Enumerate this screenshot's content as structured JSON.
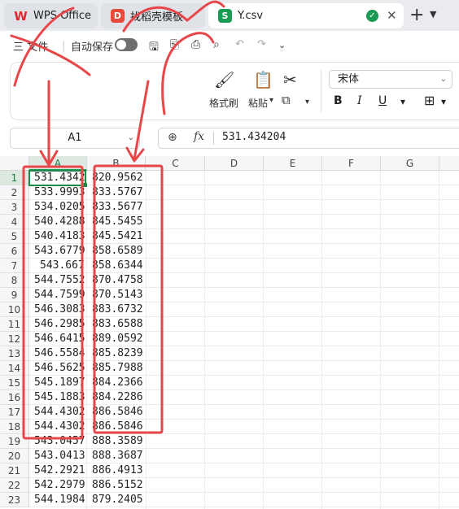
{
  "tabs": {
    "wps": "WPS Office",
    "template": "找稻壳模板",
    "file": "Y.csv",
    "template_badge": "D",
    "file_badge": "S"
  },
  "quick_access": {
    "menu": "三 文件",
    "autosave": "自动保存"
  },
  "ribbon": {
    "format_painter": "格式刷",
    "paste": "粘贴",
    "font_name": "宋体",
    "bold": "B",
    "italic": "I",
    "underline": "U"
  },
  "formula_bar": {
    "cell_ref": "A1",
    "fx": "fx",
    "value": "531.434204"
  },
  "columns": [
    "A",
    "B",
    "C",
    "D",
    "E",
    "F",
    "G"
  ],
  "rows": [
    {
      "n": "1",
      "a": "531.4342",
      "b": "820.9562"
    },
    {
      "n": "2",
      "a": "533.9993",
      "b": "833.5767"
    },
    {
      "n": "3",
      "a": "534.0205",
      "b": "833.5677"
    },
    {
      "n": "4",
      "a": "540.4288",
      "b": "845.5455"
    },
    {
      "n": "5",
      "a": "540.4183",
      "b": "845.5421"
    },
    {
      "n": "6",
      "a": "543.6779",
      "b": "858.6589"
    },
    {
      "n": "7",
      "a": "543.667",
      "b": "858.6344"
    },
    {
      "n": "8",
      "a": "544.7552",
      "b": "870.4758"
    },
    {
      "n": "9",
      "a": "544.7599",
      "b": "870.5143"
    },
    {
      "n": "10",
      "a": "546.3083",
      "b": "883.6732"
    },
    {
      "n": "11",
      "a": "546.2985",
      "b": "883.6588"
    },
    {
      "n": "12",
      "a": "546.6415",
      "b": "889.0592"
    },
    {
      "n": "13",
      "a": "546.5584",
      "b": "885.8239"
    },
    {
      "n": "14",
      "a": "546.5625",
      "b": "885.7988"
    },
    {
      "n": "15",
      "a": "545.1897",
      "b": "884.2366"
    },
    {
      "n": "16",
      "a": "545.1883",
      "b": "884.2286"
    },
    {
      "n": "17",
      "a": "544.4302",
      "b": "886.5846"
    },
    {
      "n": "18",
      "a": "544.4302",
      "b": "886.5846"
    },
    {
      "n": "19",
      "a": "543.0457",
      "b": "888.3589"
    },
    {
      "n": "20",
      "a": "543.0413",
      "b": "888.3687"
    },
    {
      "n": "21",
      "a": "542.2921",
      "b": "886.4913"
    },
    {
      "n": "22",
      "a": "542.2979",
      "b": "886.5152"
    },
    {
      "n": "23",
      "a": "544.1984",
      "b": "879.2405"
    }
  ],
  "colors": {
    "accent_green": "#1a9a52",
    "annotation_red": "#e8474a"
  }
}
